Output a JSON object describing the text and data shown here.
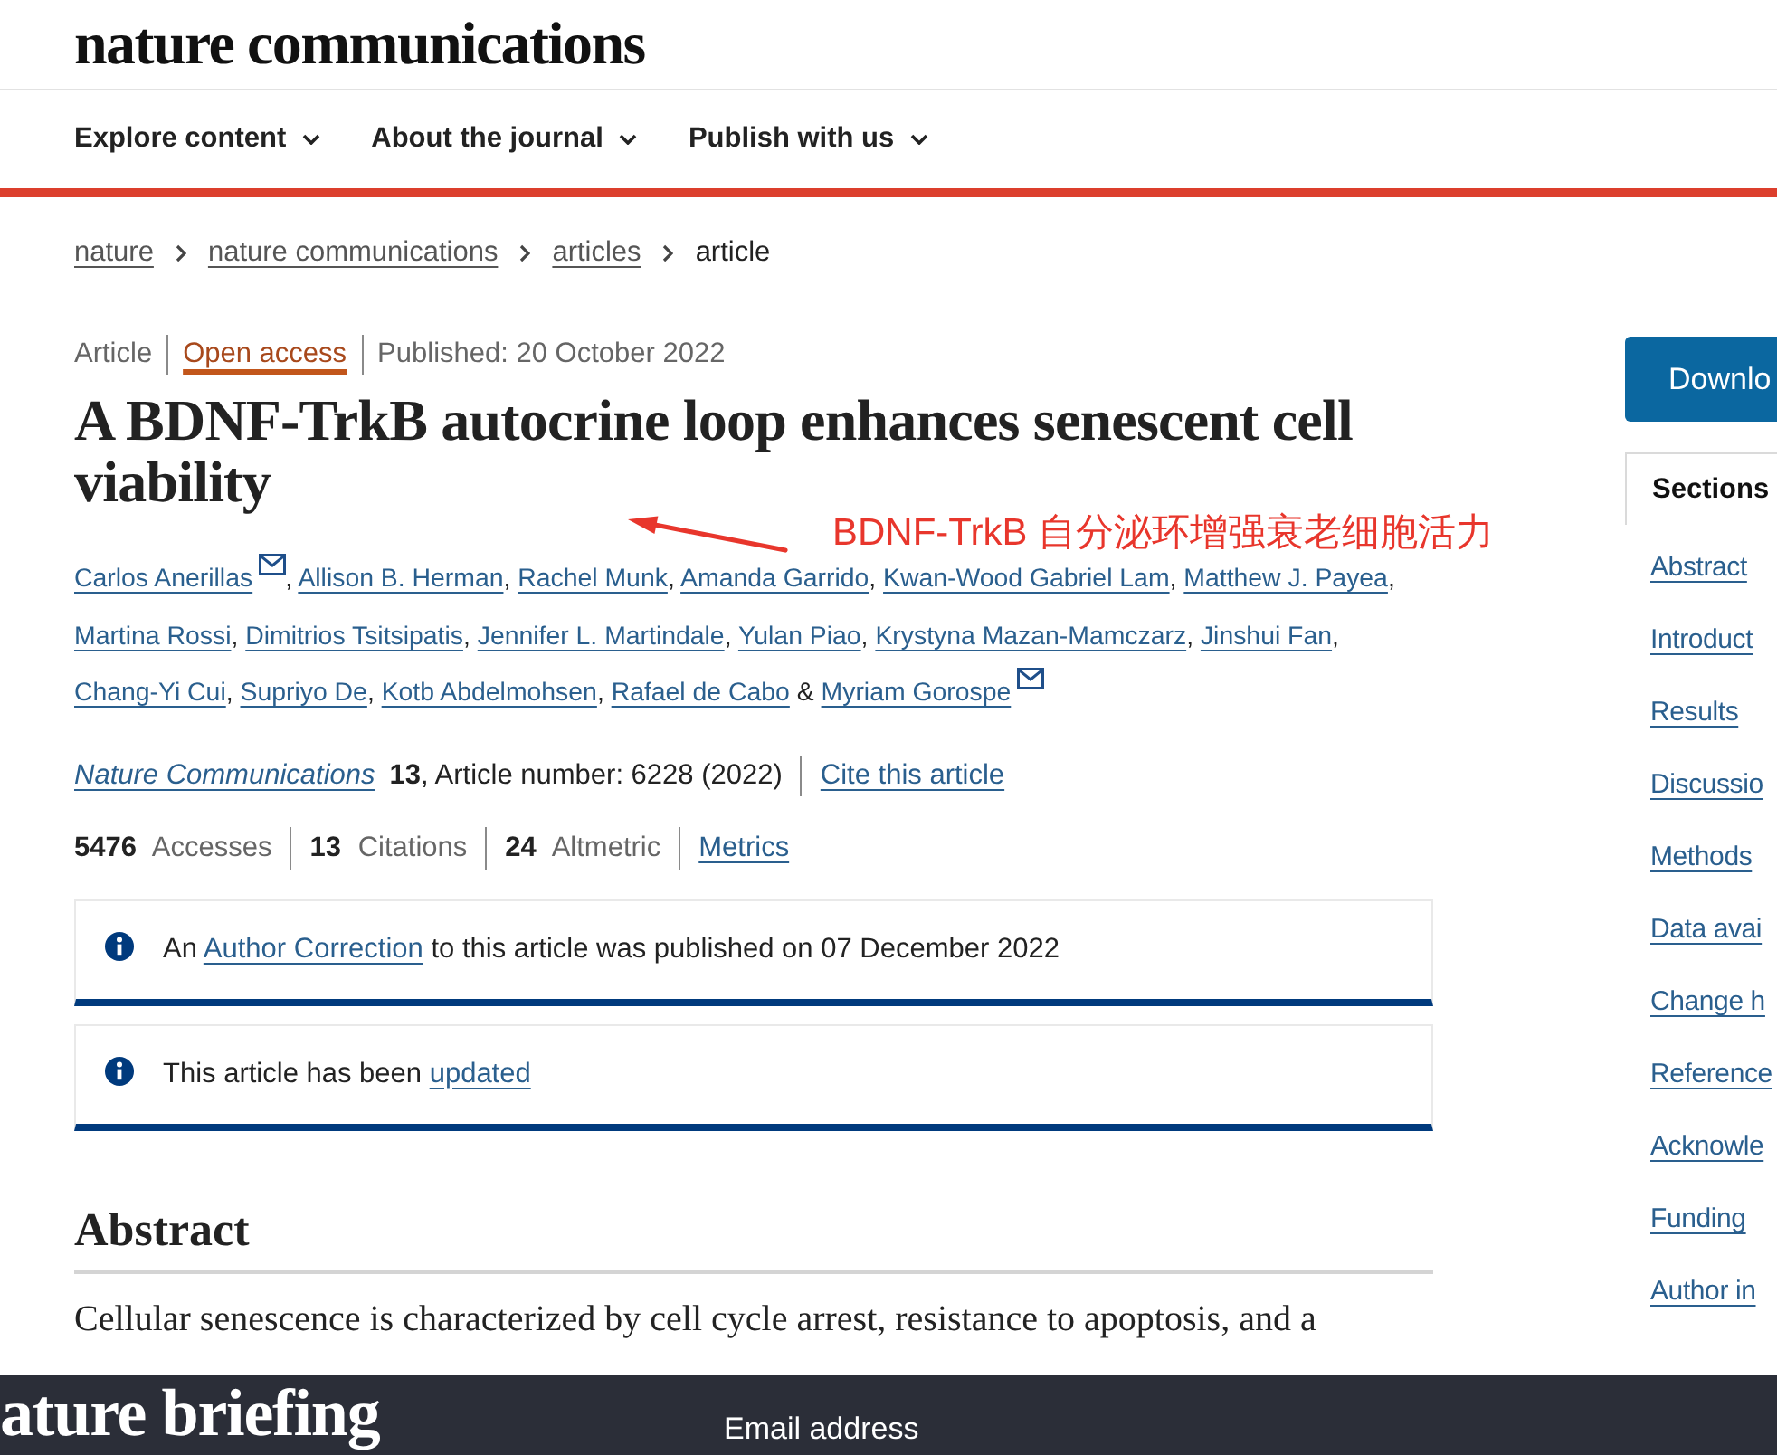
{
  "header": {
    "logo": "nature communications"
  },
  "nav": [
    {
      "label": "Explore content"
    },
    {
      "label": "About the journal"
    },
    {
      "label": "Publish with us"
    }
  ],
  "breadcrumb": [
    {
      "label": "nature",
      "kind": "link"
    },
    {
      "label": "nature communications",
      "kind": "link"
    },
    {
      "label": "articles",
      "kind": "link"
    },
    {
      "label": "article",
      "kind": "current"
    }
  ],
  "article": {
    "type": "Article",
    "access": "Open access",
    "published": "Published: 20 October 2022",
    "title": "A BDNF-TrkB autocrine loop enhances senescent cell viability"
  },
  "annotation": {
    "text": "BDNF-TrkB 自分泌环增强衰老细胞活力"
  },
  "authors": [
    {
      "name": "Carlos Anerillas",
      "email": true,
      "after": ", "
    },
    {
      "name": "Allison B. Herman",
      "email": false,
      "after": ", "
    },
    {
      "name": "Rachel Munk",
      "email": false,
      "after": ", "
    },
    {
      "name": "Amanda Garrido",
      "email": false,
      "after": ", "
    },
    {
      "name": "Kwan-Wood Gabriel Lam",
      "email": false,
      "after": ", "
    },
    {
      "name": "Matthew J. Payea",
      "email": false,
      "after": ", "
    },
    {
      "name": "Martina Rossi",
      "email": false,
      "after": ", "
    },
    {
      "name": "Dimitrios Tsitsipatis",
      "email": false,
      "after": ", "
    },
    {
      "name": "Jennifer L. Martindale",
      "email": false,
      "after": ", "
    },
    {
      "name": "Yulan Piao",
      "email": false,
      "after": ", "
    },
    {
      "name": "Krystyna Mazan-Mamczarz",
      "email": false,
      "after": ", "
    },
    {
      "name": "Jinshui Fan",
      "email": false,
      "after": ", "
    },
    {
      "name": "Chang-Yi Cui",
      "email": false,
      "after": ", "
    },
    {
      "name": "Supriyo De",
      "email": false,
      "after": ", "
    },
    {
      "name": "Kotb Abdelmohsen",
      "email": false,
      "after": ", "
    },
    {
      "name": "Rafael de Cabo",
      "email": false,
      "after": " & "
    },
    {
      "name": "Myriam Gorospe",
      "email": true
    }
  ],
  "citation": {
    "journal": "Nature Communications",
    "details": "**13**, Article number: 6228 (2022)",
    "cite_link": "Cite this article"
  },
  "metrics": [
    "**5476** Accesses",
    "**13** Citations",
    "**24** Altmetric"
  ],
  "metrics_link": "Metrics",
  "notices": [
    {
      "before": "An ",
      "link": "Author Correction",
      "after": " to this article was published on 07 December 2022"
    },
    {
      "before": "This article has been ",
      "link": "updated"
    }
  ],
  "abstract": {
    "heading": "Abstract",
    "text": "Cellular senescence is characterized by cell cycle arrest, resistance to apoptosis, and a"
  },
  "sidebar": {
    "download": "Downlo",
    "tab": "Sections",
    "items": [
      "Abstract",
      "Introduct",
      "Results",
      "Discussio",
      "Methods",
      "Data avai",
      "Change h",
      "Reference",
      "Acknowle",
      "Funding",
      "Author in"
    ]
  },
  "footer": {
    "brand": "ature briefing",
    "email_label": "Email address"
  }
}
